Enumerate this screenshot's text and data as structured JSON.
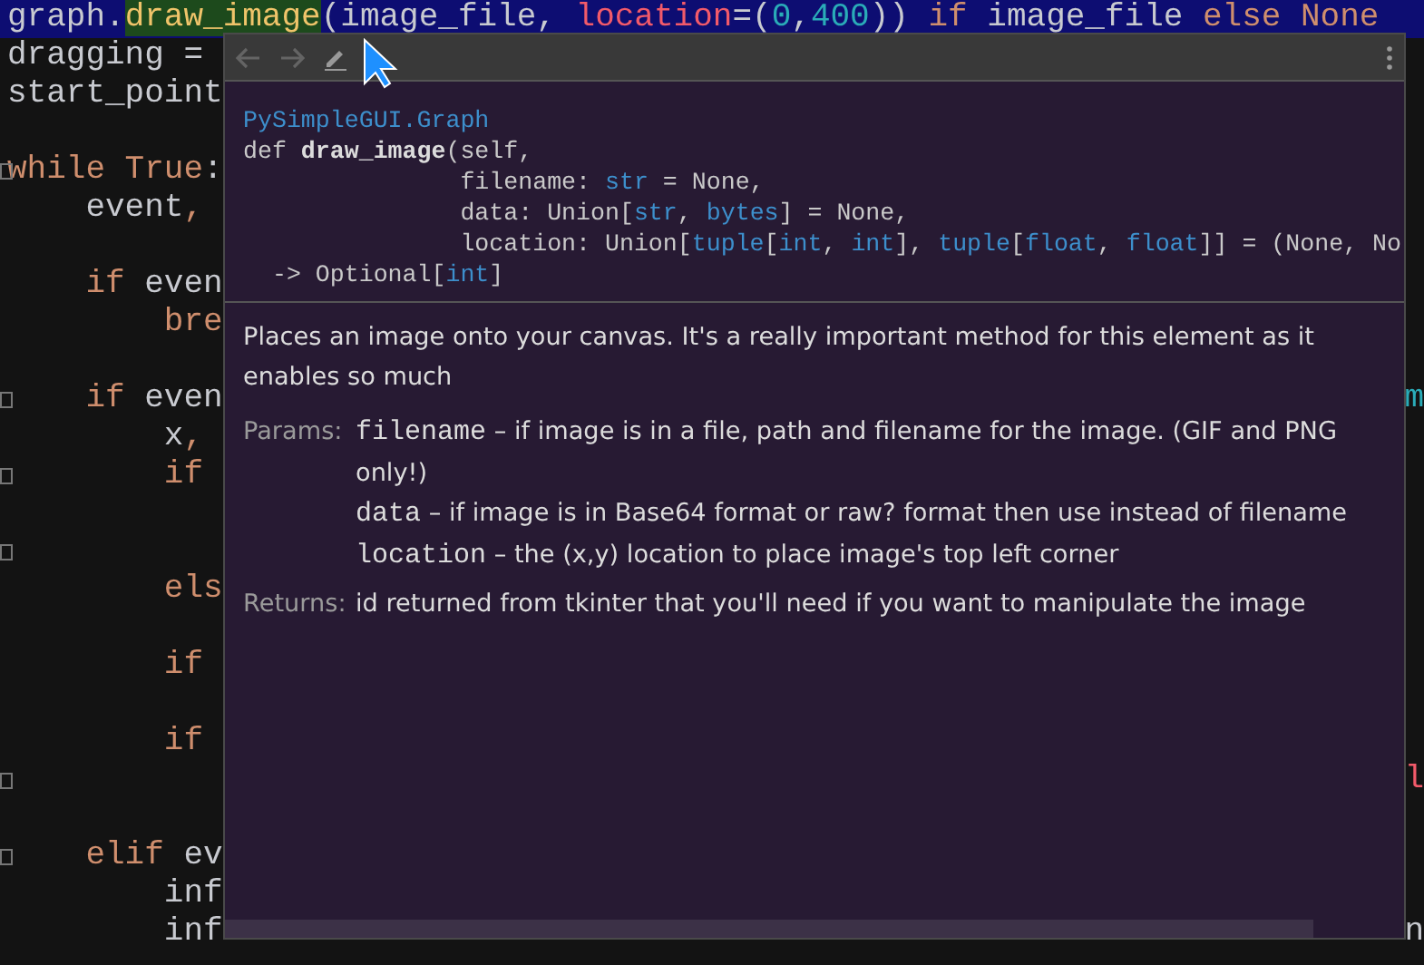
{
  "editor": {
    "lines": [
      {
        "highlighted": true,
        "segments": [
          {
            "text": "graph.",
            "kind": "plain"
          },
          {
            "text": "draw_image",
            "kind": "call"
          },
          {
            "text": "(image_file, ",
            "kind": "plain"
          },
          {
            "text": "location",
            "kind": "param"
          },
          {
            "text": "=(",
            "kind": "plain"
          },
          {
            "text": "0",
            "kind": "number"
          },
          {
            "text": ",",
            "kind": "plain"
          },
          {
            "text": "400",
            "kind": "number"
          },
          {
            "text": ")) ",
            "kind": "plain"
          },
          {
            "text": "if",
            "kind": "keyword"
          },
          {
            "text": " image_file ",
            "kind": "plain"
          },
          {
            "text": "else None",
            "kind": "keyword"
          }
        ]
      },
      {
        "segments": [
          {
            "text": "dragging =",
            "kind": "plain"
          }
        ]
      },
      {
        "segments": [
          {
            "text": "start_point",
            "kind": "plain"
          }
        ]
      },
      {
        "blank_before": true,
        "fold": true,
        "segments": [
          {
            "text": "while True",
            "kind": "keyword"
          },
          {
            "text": ":",
            "kind": "plain"
          }
        ]
      },
      {
        "segments": [
          {
            "text": "    event",
            "kind": "plain"
          },
          {
            "text": ",",
            "kind": "keyword"
          }
        ]
      },
      {
        "blank_before": true,
        "segments": [
          {
            "text": "    if",
            "kind": "keyword"
          },
          {
            "text": " even",
            "kind": "plain"
          }
        ]
      },
      {
        "segments": [
          {
            "text": "        bre",
            "kind": "keyword"
          }
        ]
      },
      {
        "blank_before": true,
        "fold": true,
        "segments": [
          {
            "text": "    if",
            "kind": "keyword"
          },
          {
            "text": " even",
            "kind": "plain"
          }
        ],
        "right": {
          "text": "m",
          "kind": "number"
        }
      },
      {
        "segments": [
          {
            "text": "        x",
            "kind": "plain"
          },
          {
            "text": ",",
            "kind": "keyword"
          }
        ]
      },
      {
        "fold": true,
        "segments": [
          {
            "text": "        if",
            "kind": "keyword"
          }
        ]
      },
      {
        "blank_before": true,
        "fold": true
      },
      {
        "segments": [
          {
            "text": "        els",
            "kind": "keyword"
          }
        ]
      },
      {
        "blank_before": true,
        "segments": [
          {
            "text": "        if",
            "kind": "keyword"
          }
        ]
      },
      {
        "blank_before": true,
        "segments": [
          {
            "text": "        if",
            "kind": "keyword"
          }
        ]
      },
      {
        "fold": true,
        "right": {
          "text": "l",
          "kind": "param"
        }
      },
      {
        "blank_before": true,
        "fold": true,
        "segments": [
          {
            "text": "    elif",
            "kind": "keyword"
          },
          {
            "text": " ev",
            "kind": "plain"
          }
        ]
      },
      {
        "segments": [
          {
            "text": "        inf",
            "kind": "plain"
          }
        ]
      },
      {
        "segments": [
          {
            "text": "        inf",
            "kind": "plain"
          }
        ],
        "right": {
          "text": "n",
          "kind": "plain"
        }
      }
    ]
  },
  "popup": {
    "toolbar": {
      "back_disabled": true,
      "forward_disabled": true
    },
    "signature": [
      [
        {
          "text": "PySimpleGUI.Graph",
          "kind": "link"
        }
      ],
      [
        {
          "text": "def ",
          "kind": "plain"
        },
        {
          "text": "draw_image",
          "kind": "bold"
        },
        {
          "text": "(self,",
          "kind": "plain"
        }
      ],
      [
        {
          "text": "               filename: ",
          "kind": "plain"
        },
        {
          "text": "str",
          "kind": "type"
        },
        {
          "text": " = None,",
          "kind": "plain"
        }
      ],
      [
        {
          "text": "               data: Union[",
          "kind": "plain"
        },
        {
          "text": "str",
          "kind": "type"
        },
        {
          "text": ", ",
          "kind": "plain"
        },
        {
          "text": "bytes",
          "kind": "type"
        },
        {
          "text": "] = None,",
          "kind": "plain"
        }
      ],
      [
        {
          "text": "               location: Union[",
          "kind": "plain"
        },
        {
          "text": "tuple",
          "kind": "type"
        },
        {
          "text": "[",
          "kind": "plain"
        },
        {
          "text": "int",
          "kind": "type"
        },
        {
          "text": ", ",
          "kind": "plain"
        },
        {
          "text": "int",
          "kind": "type"
        },
        {
          "text": "], ",
          "kind": "plain"
        },
        {
          "text": "tuple",
          "kind": "type"
        },
        {
          "text": "[",
          "kind": "plain"
        },
        {
          "text": "float",
          "kind": "type"
        },
        {
          "text": ", ",
          "kind": "plain"
        },
        {
          "text": "float",
          "kind": "type"
        },
        {
          "text": "]] = (None, No",
          "kind": "plain"
        }
      ],
      [
        {
          "text": "  -> Optional[",
          "kind": "plain"
        },
        {
          "text": "int",
          "kind": "type"
        },
        {
          "text": "]",
          "kind": "plain"
        }
      ]
    ],
    "description": "Places an image onto your canvas. It's a really important method for this element as it enables so much",
    "params_label": "Params:",
    "params": [
      {
        "name": "filename",
        "text": "– if image is in a file, path and filename for the image. (GIF and PNG only!)"
      },
      {
        "name": "data",
        "text": "– if image is in Base64 format or raw? format then use instead of filename"
      },
      {
        "name": "location",
        "text": "– the (x,y) location to place image's top left corner"
      }
    ],
    "returns_label": "Returns:",
    "returns": "id returned from tkinter that you'll need if you want to manipulate the image"
  }
}
